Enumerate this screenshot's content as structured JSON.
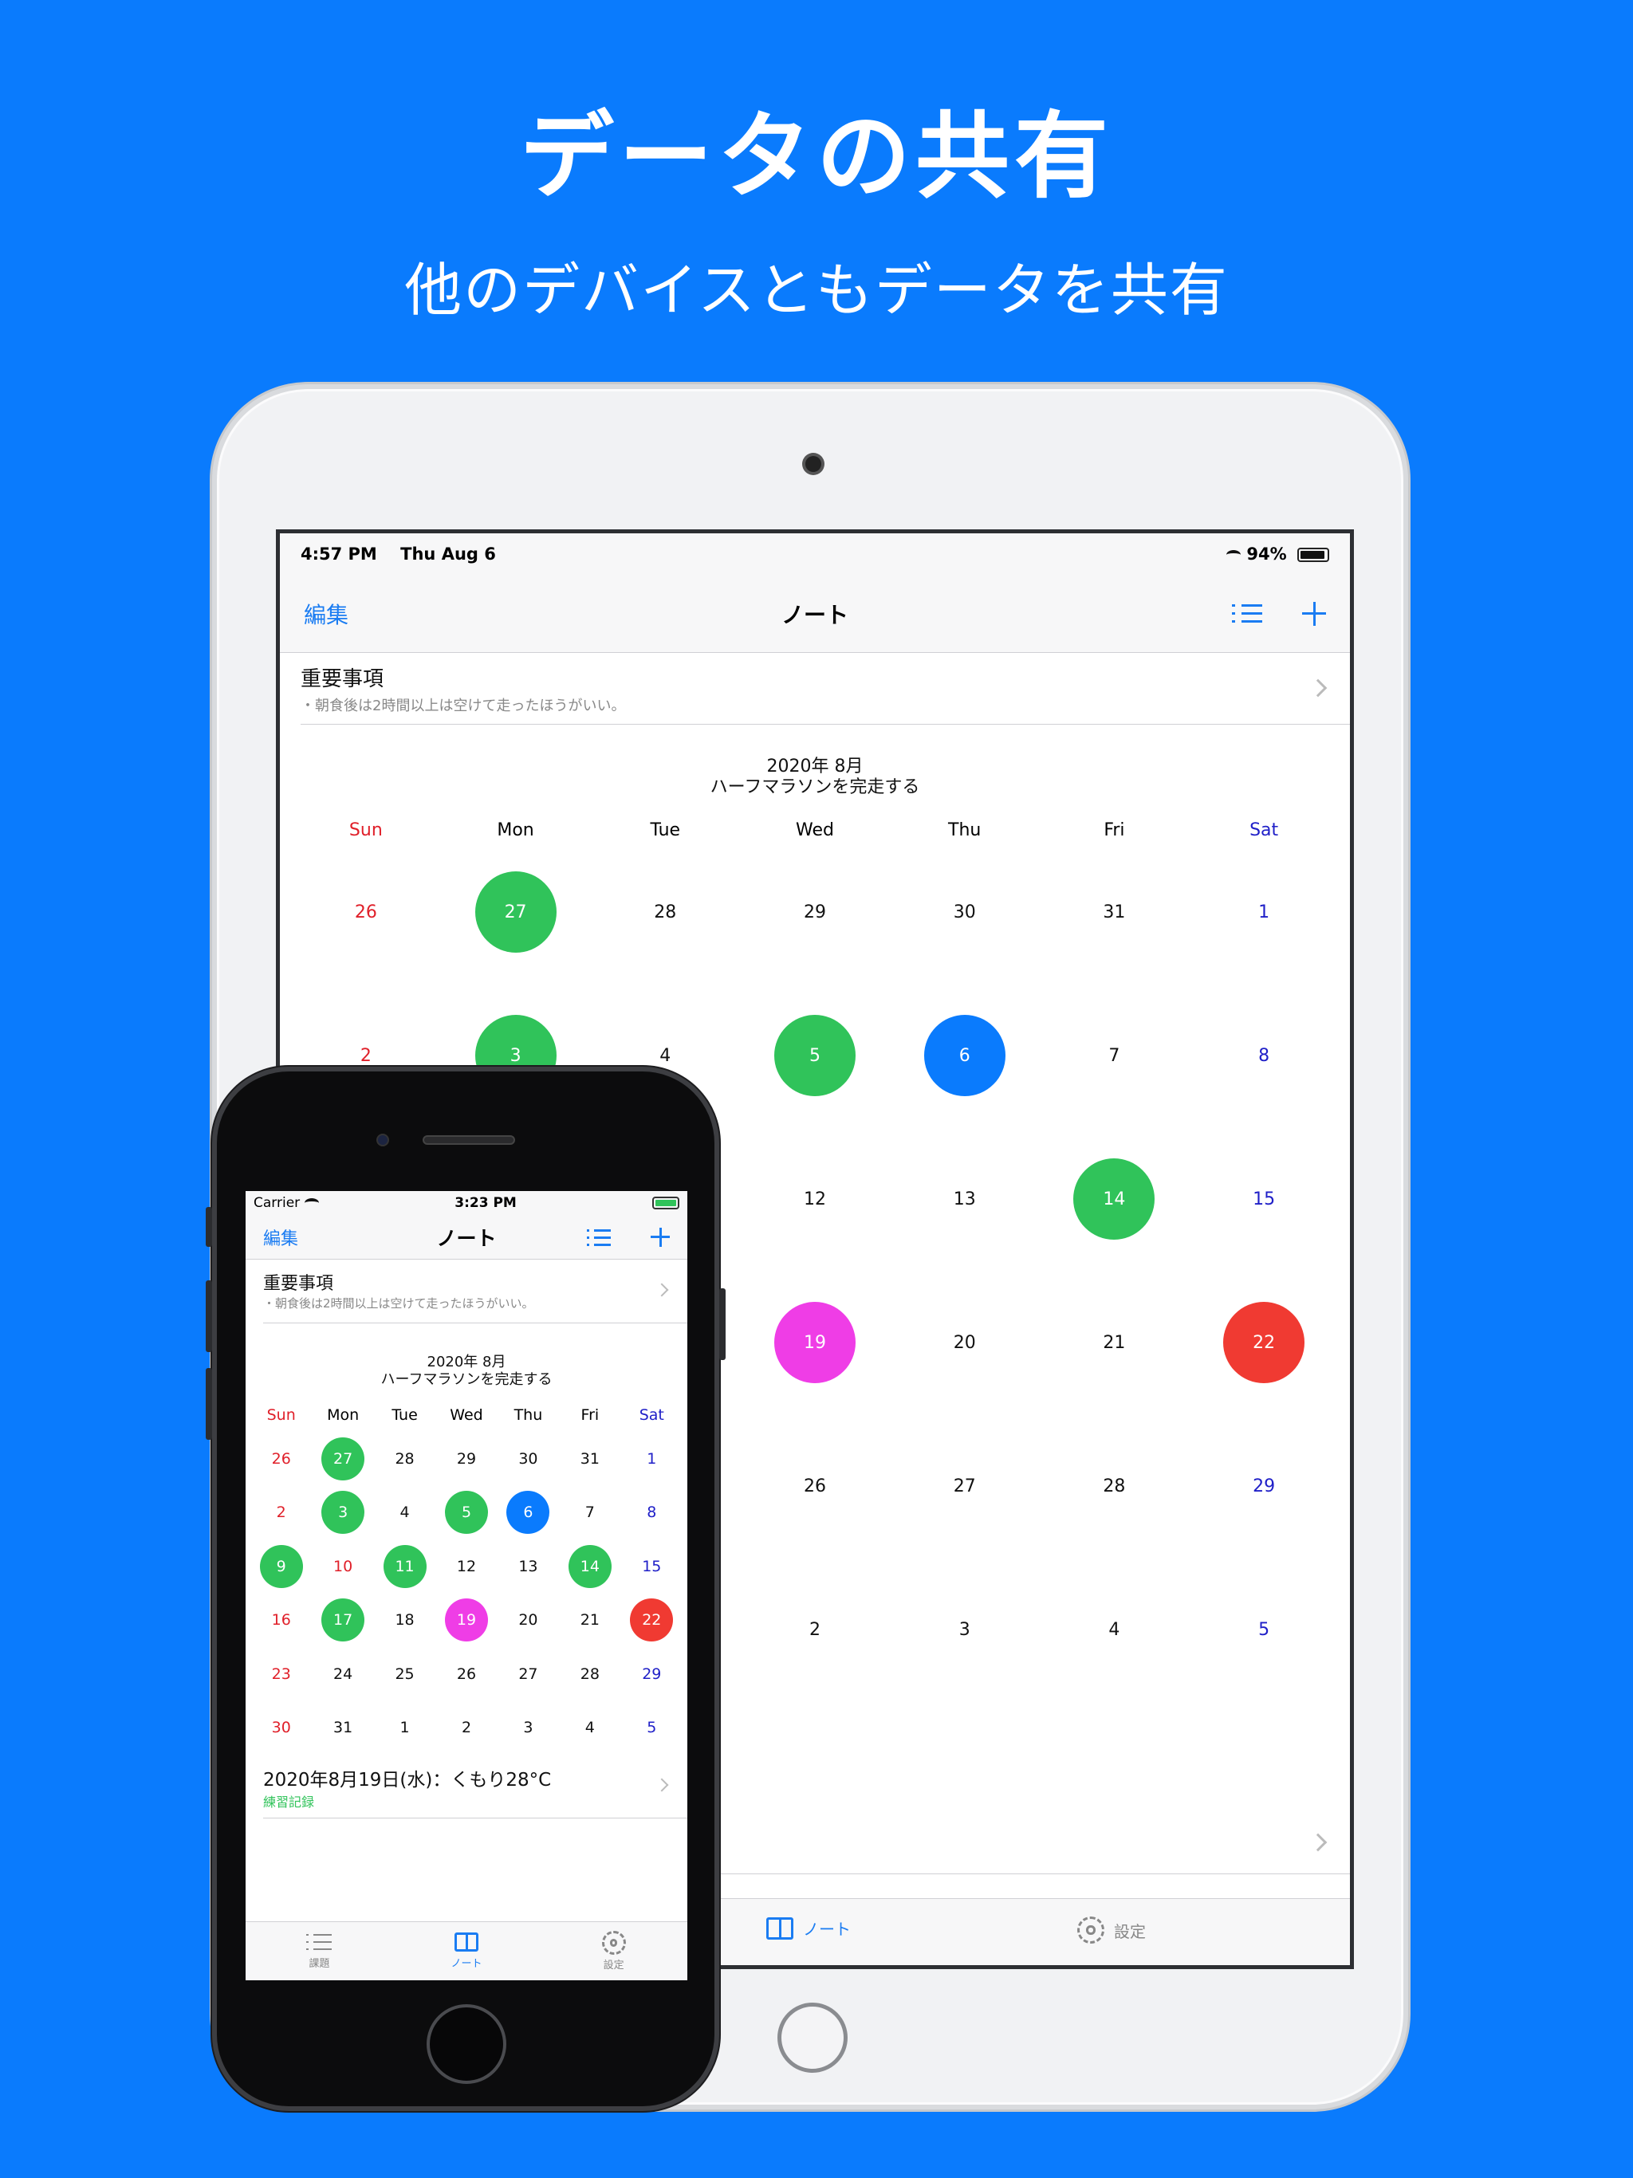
{
  "hero": {
    "title": "データの共有",
    "subtitle": "他のデバイスともデータを共有"
  },
  "colors": {
    "background": "#0a7bfd",
    "accent": "#1a7cf2",
    "green": "#30c35a",
    "blue": "#0a7bfd",
    "magenta": "#ef3de6",
    "red": "#f03a32",
    "sunday": "#e0202a",
    "saturday": "#2020c8"
  },
  "ipad": {
    "status": {
      "time": "4:57 PM",
      "date": "Thu Aug 6",
      "battery": "94%",
      "battery_level": 0.94
    },
    "nav": {
      "edit": "編集",
      "title": "ノート",
      "list_icon": "list-icon",
      "add_icon": "plus-icon"
    },
    "important": {
      "title": "重要事項",
      "note": "・朝食後は2時間以上は空けて走ったほうがいい。"
    },
    "calendar": {
      "month": "2020年 8月",
      "goal": "ハーフマラソンを完走する",
      "weekdays": [
        "Sun",
        "Mon",
        "Tue",
        "Wed",
        "Thu",
        "Fri",
        "Sat"
      ],
      "weeks": [
        [
          {
            "d": "26",
            "c": "sun"
          },
          {
            "d": "27",
            "f": "green"
          },
          {
            "d": "28"
          },
          {
            "d": "29"
          },
          {
            "d": "30"
          },
          {
            "d": "31"
          },
          {
            "d": "1",
            "c": "sat"
          }
        ],
        [
          {
            "d": "2",
            "c": "sun"
          },
          {
            "d": "3",
            "f": "green"
          },
          {
            "d": "4"
          },
          {
            "d": "5",
            "f": "green"
          },
          {
            "d": "6",
            "f": "blue"
          },
          {
            "d": "7"
          },
          {
            "d": "8",
            "c": "sat"
          }
        ],
        [
          {
            "d": "9",
            "f": "green"
          },
          {
            "d": "10",
            "c": "sun"
          },
          {
            "d": "11",
            "f": "green"
          },
          {
            "d": "12"
          },
          {
            "d": "13"
          },
          {
            "d": "14",
            "f": "green"
          },
          {
            "d": "15",
            "c": "sat"
          }
        ],
        [
          {
            "d": "16",
            "c": "sun"
          },
          {
            "d": "17",
            "f": "green"
          },
          {
            "d": "18"
          },
          {
            "d": "19",
            "f": "magenta"
          },
          {
            "d": "20"
          },
          {
            "d": "21"
          },
          {
            "d": "22",
            "f": "red"
          }
        ],
        [
          {
            "d": "23",
            "c": "sun"
          },
          {
            "d": "24"
          },
          {
            "d": "25"
          },
          {
            "d": "26"
          },
          {
            "d": "27"
          },
          {
            "d": "28"
          },
          {
            "d": "29",
            "c": "sat"
          }
        ],
        [
          {
            "d": "30",
            "c": "sun"
          },
          {
            "d": "31"
          },
          {
            "d": "1"
          },
          {
            "d": "2"
          },
          {
            "d": "3"
          },
          {
            "d": "4"
          },
          {
            "d": "5",
            "c": "sat"
          }
        ]
      ]
    },
    "tabbar": {
      "note": "ノート",
      "settings": "設定"
    }
  },
  "iphone": {
    "status": {
      "carrier": "Carrier",
      "time": "3:23 PM"
    },
    "nav": {
      "edit": "編集",
      "title": "ノート"
    },
    "important": {
      "title": "重要事項",
      "note": "・朝食後は2時間以上は空けて走ったほうがいい。"
    },
    "calendar": {
      "month": "2020年 8月",
      "goal": "ハーフマラソンを完走する",
      "weekdays": [
        "Sun",
        "Mon",
        "Tue",
        "Wed",
        "Thu",
        "Fri",
        "Sat"
      ]
    },
    "detail": {
      "title": "2020年8月19日(水)：くもり28°C",
      "subtitle": "練習記録"
    },
    "tabbar": {
      "tasks": "課題",
      "note": "ノート",
      "settings": "設定"
    }
  }
}
